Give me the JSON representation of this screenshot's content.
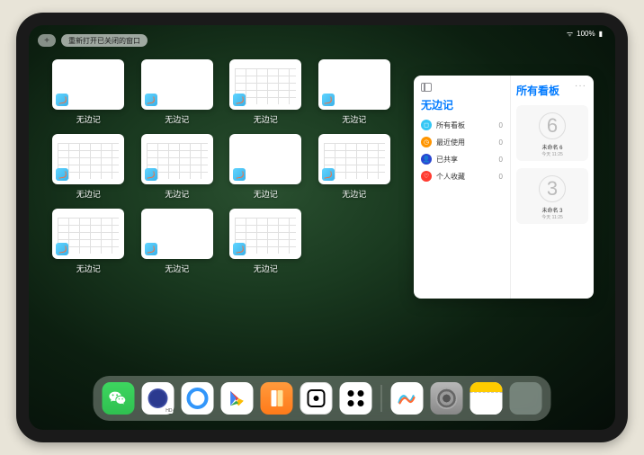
{
  "status": {
    "battery": "100%",
    "signal": "●●●"
  },
  "top": {
    "add": "+",
    "reopen": "重新打开已关闭的窗口"
  },
  "expose": {
    "app_label": "无边记",
    "count": 11
  },
  "panel": {
    "left_title": "无边记",
    "right_title": "所有看板",
    "more": "···",
    "items": [
      {
        "label": "所有看板",
        "count": "0",
        "icon": "boards"
      },
      {
        "label": "最近使用",
        "count": "0",
        "icon": "recent"
      },
      {
        "label": "已共享",
        "count": "0",
        "icon": "shared"
      },
      {
        "label": "个人收藏",
        "count": "0",
        "icon": "fav"
      }
    ],
    "boards": [
      {
        "glyph": "6",
        "name": "未命名 6",
        "date": "今天 11:25"
      },
      {
        "glyph": "3",
        "name": "未命名 3",
        "date": "今天 11:25"
      }
    ]
  },
  "dock": {
    "apps": [
      {
        "name": "wechat"
      },
      {
        "name": "quark"
      },
      {
        "name": "qqbrowser"
      },
      {
        "name": "play"
      },
      {
        "name": "books"
      },
      {
        "name": "dice"
      },
      {
        "name": "pattern"
      }
    ],
    "recent": [
      {
        "name": "freeform"
      },
      {
        "name": "settings"
      },
      {
        "name": "notes"
      },
      {
        "name": "app-folder"
      }
    ]
  }
}
